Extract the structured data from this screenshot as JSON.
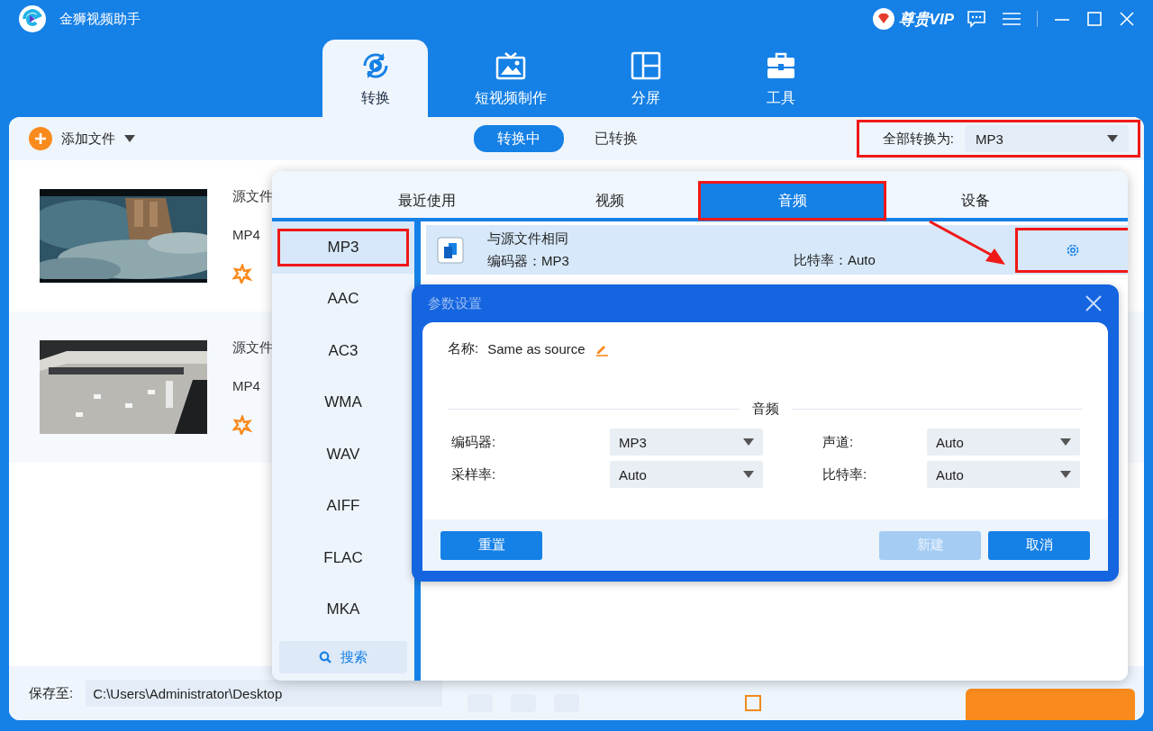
{
  "window": {
    "title": "金狮视频助手",
    "vip_label": "尊贵VIP"
  },
  "nav_tabs": [
    {
      "label": "转换",
      "kind": "convert",
      "selected": true
    },
    {
      "label": "短视频制作",
      "kind": "tv",
      "selected": false
    },
    {
      "label": "分屏",
      "kind": "split",
      "selected": false
    },
    {
      "label": "工具",
      "kind": "toolbox",
      "selected": false
    }
  ],
  "toolbar": {
    "add_files": "添加文件",
    "segments": [
      {
        "label": "转换中",
        "selected": true
      },
      {
        "label": "已转换",
        "selected": false
      }
    ],
    "convert_all_label": "全部转换为:",
    "convert_all_value": "MP3",
    "highlighted": true
  },
  "files": [
    {
      "source_label": "源文件",
      "format": "MP4"
    },
    {
      "source_label": "源文件",
      "format": "MP4"
    }
  ],
  "bottom_bar": {
    "save_label": "保存至:",
    "path": "C:\\Users\\Administrator\\Desktop",
    "merge_checked": false
  },
  "format_popup": {
    "tabs": [
      {
        "label": "最近使用",
        "selected": false,
        "highlighted": false
      },
      {
        "label": "视频",
        "selected": false,
        "highlighted": false
      },
      {
        "label": "音频",
        "selected": true,
        "highlighted": true
      },
      {
        "label": "设备",
        "selected": false,
        "highlighted": false
      }
    ],
    "formats": [
      {
        "label": "MP3",
        "selected": true,
        "highlighted": true
      },
      {
        "label": "AAC",
        "selected": false,
        "highlighted": false
      },
      {
        "label": "AC3",
        "selected": false,
        "highlighted": false
      },
      {
        "label": "WMA",
        "selected": false,
        "highlighted": false
      },
      {
        "label": "WAV",
        "selected": false,
        "highlighted": false
      },
      {
        "label": "AIFF",
        "selected": false,
        "highlighted": false
      },
      {
        "label": "FLAC",
        "selected": false,
        "highlighted": false
      },
      {
        "label": "MKA",
        "selected": false,
        "highlighted": false
      }
    ],
    "search_label": "搜索",
    "presets": [
      {
        "name": "与源文件相同",
        "encoder": "编码器：MP3",
        "bitrate": "比特率：Auto",
        "selected": true,
        "highlighted": true
      }
    ]
  },
  "settings_dialog": {
    "title": "参数设置",
    "name_label": "名称:",
    "name_value": "Same as source",
    "section": "音频",
    "fields": [
      {
        "label": "编码器:",
        "value": "MP3"
      },
      {
        "label": "声道:",
        "value": "Auto"
      },
      {
        "label": "采样率:",
        "value": "Auto"
      },
      {
        "label": "比特率:",
        "value": "Auto"
      }
    ],
    "buttons": [
      {
        "label": "重置",
        "disabled": false
      },
      {
        "label": "新建",
        "disabled": true
      },
      {
        "label": "取消",
        "disabled": false
      }
    ]
  }
}
